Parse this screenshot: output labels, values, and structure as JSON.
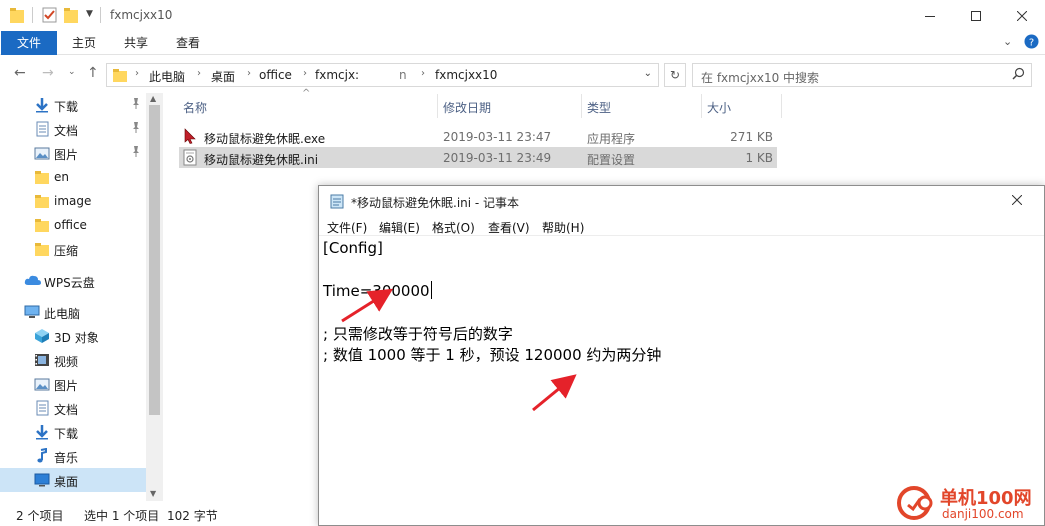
{
  "explorer": {
    "title": "fxmcjxx10",
    "ribbon": {
      "file": "文件",
      "home": "主页",
      "share": "共享",
      "view": "查看"
    },
    "breadcrumb": [
      "此电脑",
      "桌面",
      "office",
      "fxmcjx:",
      "n",
      "fxmcjxx10"
    ],
    "search_placeholder": "在 fxmcjxx10 中搜索",
    "nav_items": [
      {
        "label": "下载",
        "icon": "download-arrow-icon",
        "pinned": true
      },
      {
        "label": "文档",
        "icon": "document-icon",
        "pinned": true
      },
      {
        "label": "图片",
        "icon": "picture-icon",
        "pinned": true
      },
      {
        "label": "en",
        "icon": "folder-icon",
        "pinned": false
      },
      {
        "label": "image",
        "icon": "folder-icon",
        "pinned": false
      },
      {
        "label": "office",
        "icon": "folder-icon",
        "pinned": false
      },
      {
        "label": "压缩",
        "icon": "folder-icon",
        "pinned": false
      },
      {
        "label": "WPS云盘",
        "icon": "cloud-icon",
        "pinned": false
      },
      {
        "label": "此电脑",
        "icon": "computer-icon",
        "pinned": false
      },
      {
        "label": "3D 对象",
        "icon": "cube-3d-icon",
        "pinned": false
      },
      {
        "label": "视频",
        "icon": "video-icon",
        "pinned": false
      },
      {
        "label": "图片",
        "icon": "picture-icon",
        "pinned": false
      },
      {
        "label": "文档",
        "icon": "document-icon",
        "pinned": false
      },
      {
        "label": "下载",
        "icon": "download-arrow-icon",
        "pinned": false
      },
      {
        "label": "音乐",
        "icon": "music-note-icon",
        "pinned": false
      },
      {
        "label": "桌面",
        "icon": "desktop-icon",
        "pinned": false,
        "selected": true
      }
    ],
    "columns": {
      "name": "名称",
      "date": "修改日期",
      "type": "类型",
      "size": "大小"
    },
    "files": [
      {
        "name": "移动鼠标避免休眠.exe",
        "date": "2019-03-11 23:47",
        "type": "应用程序",
        "size": "271 KB",
        "icon": "app-cursor-icon"
      },
      {
        "name": "移动鼠标避免休眠.ini",
        "date": "2019-03-11 23:49",
        "type": "配置设置",
        "size": "1 KB",
        "icon": "config-file-icon",
        "selected": true
      }
    ],
    "status": {
      "count": "2 个项目",
      "selection": "选中 1 个项目",
      "bytes": "102 字节"
    }
  },
  "notepad": {
    "title": "*移动鼠标避免休眠.ini - 记事本",
    "menu": [
      "文件(F)",
      "编辑(E)",
      "格式(O)",
      "查看(V)",
      "帮助(H)"
    ],
    "lines": [
      "[Config]",
      "",
      "Time=300000",
      "",
      "; 只需修改等于符号后的数字",
      "; 数值 1000 等于 1 秒，预设 120000 约为两分钟"
    ]
  },
  "watermark": {
    "name": "单机100网",
    "url": "danji100.com"
  },
  "colors": {
    "ribbon_file": "#1b6ac3",
    "selection": "#cce4f7",
    "arrow": "#e5222a",
    "watermark": "#e2462a"
  }
}
